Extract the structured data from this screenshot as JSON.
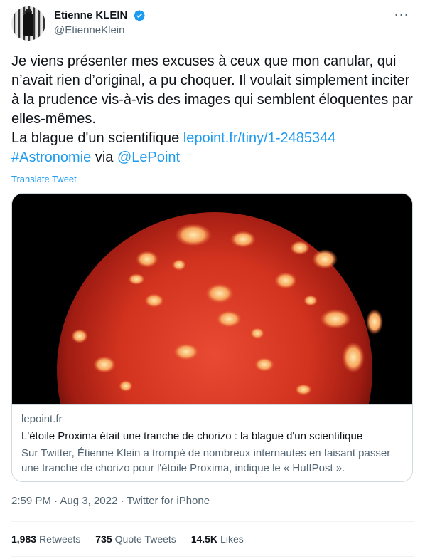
{
  "author": {
    "display_name": "Etienne KLEIN",
    "handle": "@EtienneKlein",
    "verified": true
  },
  "menu": {
    "more_icon": "more-horizontal-icon",
    "more_label": "···"
  },
  "tweet": {
    "text_before_link": "Je viens présenter mes excuses à ceux que mon canular, qui n’avait rien d’original, a pu choquer. Il voulait simplement inciter à la prudence vis-à-vis des images qui semblent éloquentes par elles-mêmes.\nLa blague d'un scientifique ",
    "link": "lepoint.fr/tiny/1-2485344",
    "hashtag": "#Astronomie",
    "via_text": " via ",
    "mention": "@LePoint",
    "translate_label": "Translate Tweet"
  },
  "card": {
    "domain": "lepoint.fr",
    "title": "L'étoile Proxima était une tranche de chorizo : la blague d'un scientifique",
    "description": "Sur Twitter, Étienne Klein a trompé de nombreux internautes en faisant passer une tranche de chorizo pour l'étoile Proxima, indique le « HuffPost »."
  },
  "meta": {
    "time": "2:59 PM",
    "separator": " · ",
    "date": "Aug 3, 2022",
    "source": "Twitter for iPhone"
  },
  "stats": {
    "retweets_count": "1,983",
    "retweets_label": "Retweets",
    "quote_count": "735",
    "quote_label": "Quote Tweets",
    "likes_count": "14.5K",
    "likes_label": "Likes"
  },
  "colors": {
    "link": "#1d9bf0",
    "text": "#0f1419",
    "secondary": "#536471",
    "verified": "#1d9bf0"
  }
}
